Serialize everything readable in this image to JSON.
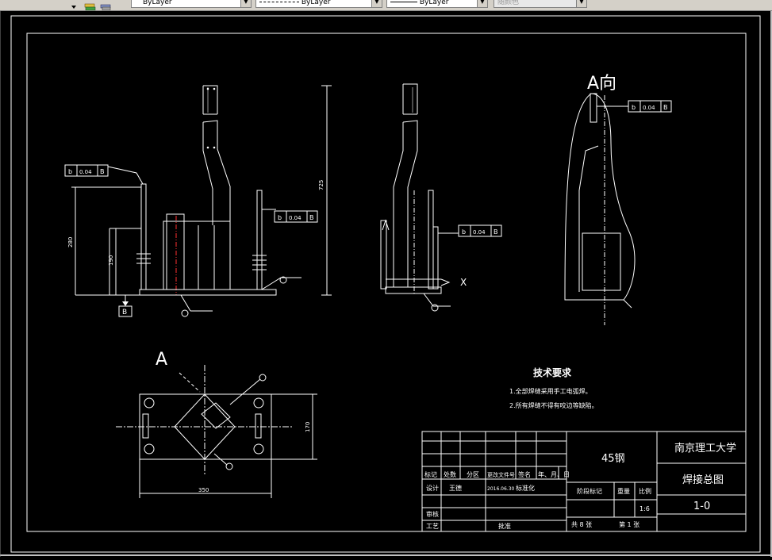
{
  "toolbar": {
    "layer_control": "ByLayer",
    "linetype_control": "ByLayer",
    "lineweight_control": "ByLayer",
    "color_control": "随颜色",
    "icons": [
      "layers-icon",
      "layer-states-icon"
    ]
  },
  "drawing": {
    "view_a_label": "A向",
    "a_marker": "A",
    "datum_b": "B",
    "x_mark": "X",
    "tolerance": {
      "symbol": "b",
      "value": "0.04",
      "datum": "B"
    },
    "dims": {
      "d725": "725",
      "d280": "280",
      "d190": "190",
      "d170": "170",
      "d350": "350"
    }
  },
  "tech_requirements": {
    "title": "技术要求",
    "items": [
      "1.全部焊缝采用手工电弧焊。",
      "2.所有焊缝不得有咬边等缺陷。"
    ]
  },
  "title_block": {
    "material": "45钢",
    "university": "南京理工大学",
    "drawing_name": "焊接总图",
    "drawing_no": "1-0",
    "header": [
      "标记",
      "处数",
      "分区",
      "更改文件号",
      "签名",
      "年、月、日"
    ],
    "design_label": "设计",
    "designer": "王德",
    "date_std": "2016.06.30",
    "std_label": "标准化",
    "stage_label": "阶段标记",
    "weight_label": "重量",
    "scale_label": "比例",
    "scale": "1:6",
    "review_label": "审核",
    "process_label": "工艺",
    "approve_label": "批准",
    "sheets": "共 8 张",
    "sheet_no": "第 1 张"
  }
}
